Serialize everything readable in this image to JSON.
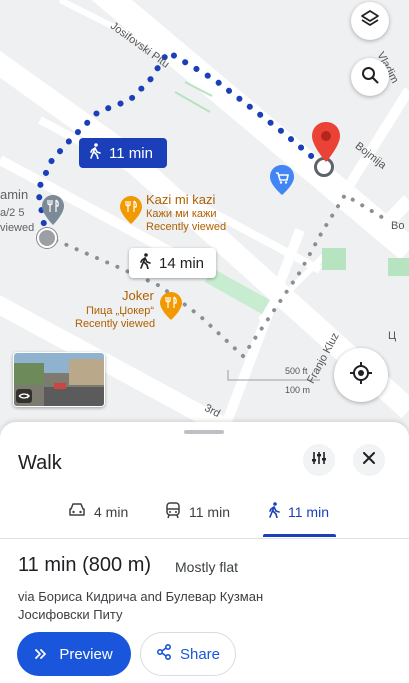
{
  "map": {
    "route_primary_time": "11 min",
    "route_alt_time": "14 min",
    "poi_kazi": {
      "name": "Kazi mi kazi",
      "alt_name": "Кажи ми кажи",
      "status": "Recently viewed"
    },
    "poi_joker": {
      "name": "Joker",
      "alt_name": "Пица „Џокер“",
      "status": "Recently viewed"
    },
    "poi_left": {
      "name": "amin",
      "alt_name": "а/2 5",
      "status": "viewed"
    },
    "streets": {
      "josifovski": "Josifovski Pitu",
      "vladimir": "Vladim",
      "bojmija": "Bojmija",
      "franjo": "Franjo Kluz",
      "third": "3rd",
      "right_edge": "Bo",
      "right_lower": "Ц"
    },
    "scale": {
      "meters": "500 ft",
      "lower": "100 m"
    }
  },
  "sheet": {
    "title": "Walk",
    "modes": [
      {
        "icon": "car-icon",
        "label": "4 min"
      },
      {
        "icon": "transit-icon",
        "label": "11 min"
      },
      {
        "icon": "walk-icon",
        "label": "11 min",
        "active": true
      }
    ],
    "summary": {
      "time_distance": "11 min (800 m)",
      "note": "Mostly flat"
    },
    "via": "via Бориса Кидрича and Булевар Кузман Јосифовски Питу",
    "preview_label": "Preview",
    "share_label": "Share"
  },
  "colors": {
    "accent": "#1a56db",
    "route_dots": "#1a3fb8",
    "pin": "#ea4335",
    "poi": "#b06000"
  }
}
